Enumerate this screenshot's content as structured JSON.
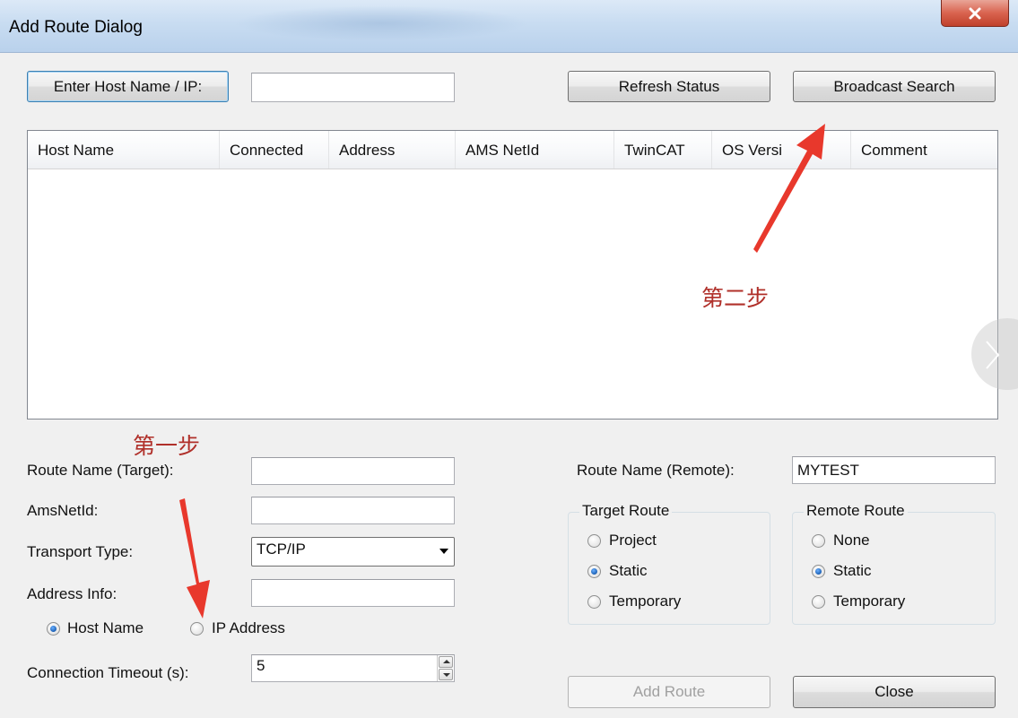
{
  "window": {
    "title": "Add Route Dialog",
    "close_glyph": "close-icon"
  },
  "top_bar": {
    "enter_host_button": "Enter Host Name / IP:",
    "host_input_value": "",
    "refresh_button": "Refresh Status",
    "broadcast_button": "Broadcast Search"
  },
  "host_list": {
    "columns": [
      "Host Name",
      "Connected",
      "Address",
      "AMS NetId",
      "TwinCAT",
      "OS Versi",
      "Comment"
    ],
    "rows": []
  },
  "annotations": {
    "step_two": "第二步",
    "step_one": "第一步",
    "color": "#e8382c"
  },
  "left_form": {
    "route_name_target_label": "Route Name (Target):",
    "route_name_target_value": "",
    "ams_netid_label": "AmsNetId:",
    "ams_netid_value": "",
    "transport_type_label": "Transport Type:",
    "transport_type_value": "TCP/IP",
    "address_info_label": "Address Info:",
    "address_info_value": "",
    "host_name_radio": "Host Name",
    "ip_address_radio": "IP Address",
    "address_mode_selected": "Host Name",
    "timeout_label": "Connection Timeout (s):",
    "timeout_value": "5"
  },
  "right_form": {
    "route_name_remote_label": "Route Name (Remote):",
    "route_name_remote_value": "MYTEST",
    "target_route": {
      "legend": "Target Route",
      "options": [
        "Project",
        "Static",
        "Temporary"
      ],
      "selected": "Static"
    },
    "remote_route": {
      "legend": "Remote Route",
      "options": [
        "None",
        "Static",
        "Temporary"
      ],
      "selected": "Static"
    }
  },
  "bottom_buttons": {
    "add_route": "Add Route",
    "close": "Close"
  }
}
